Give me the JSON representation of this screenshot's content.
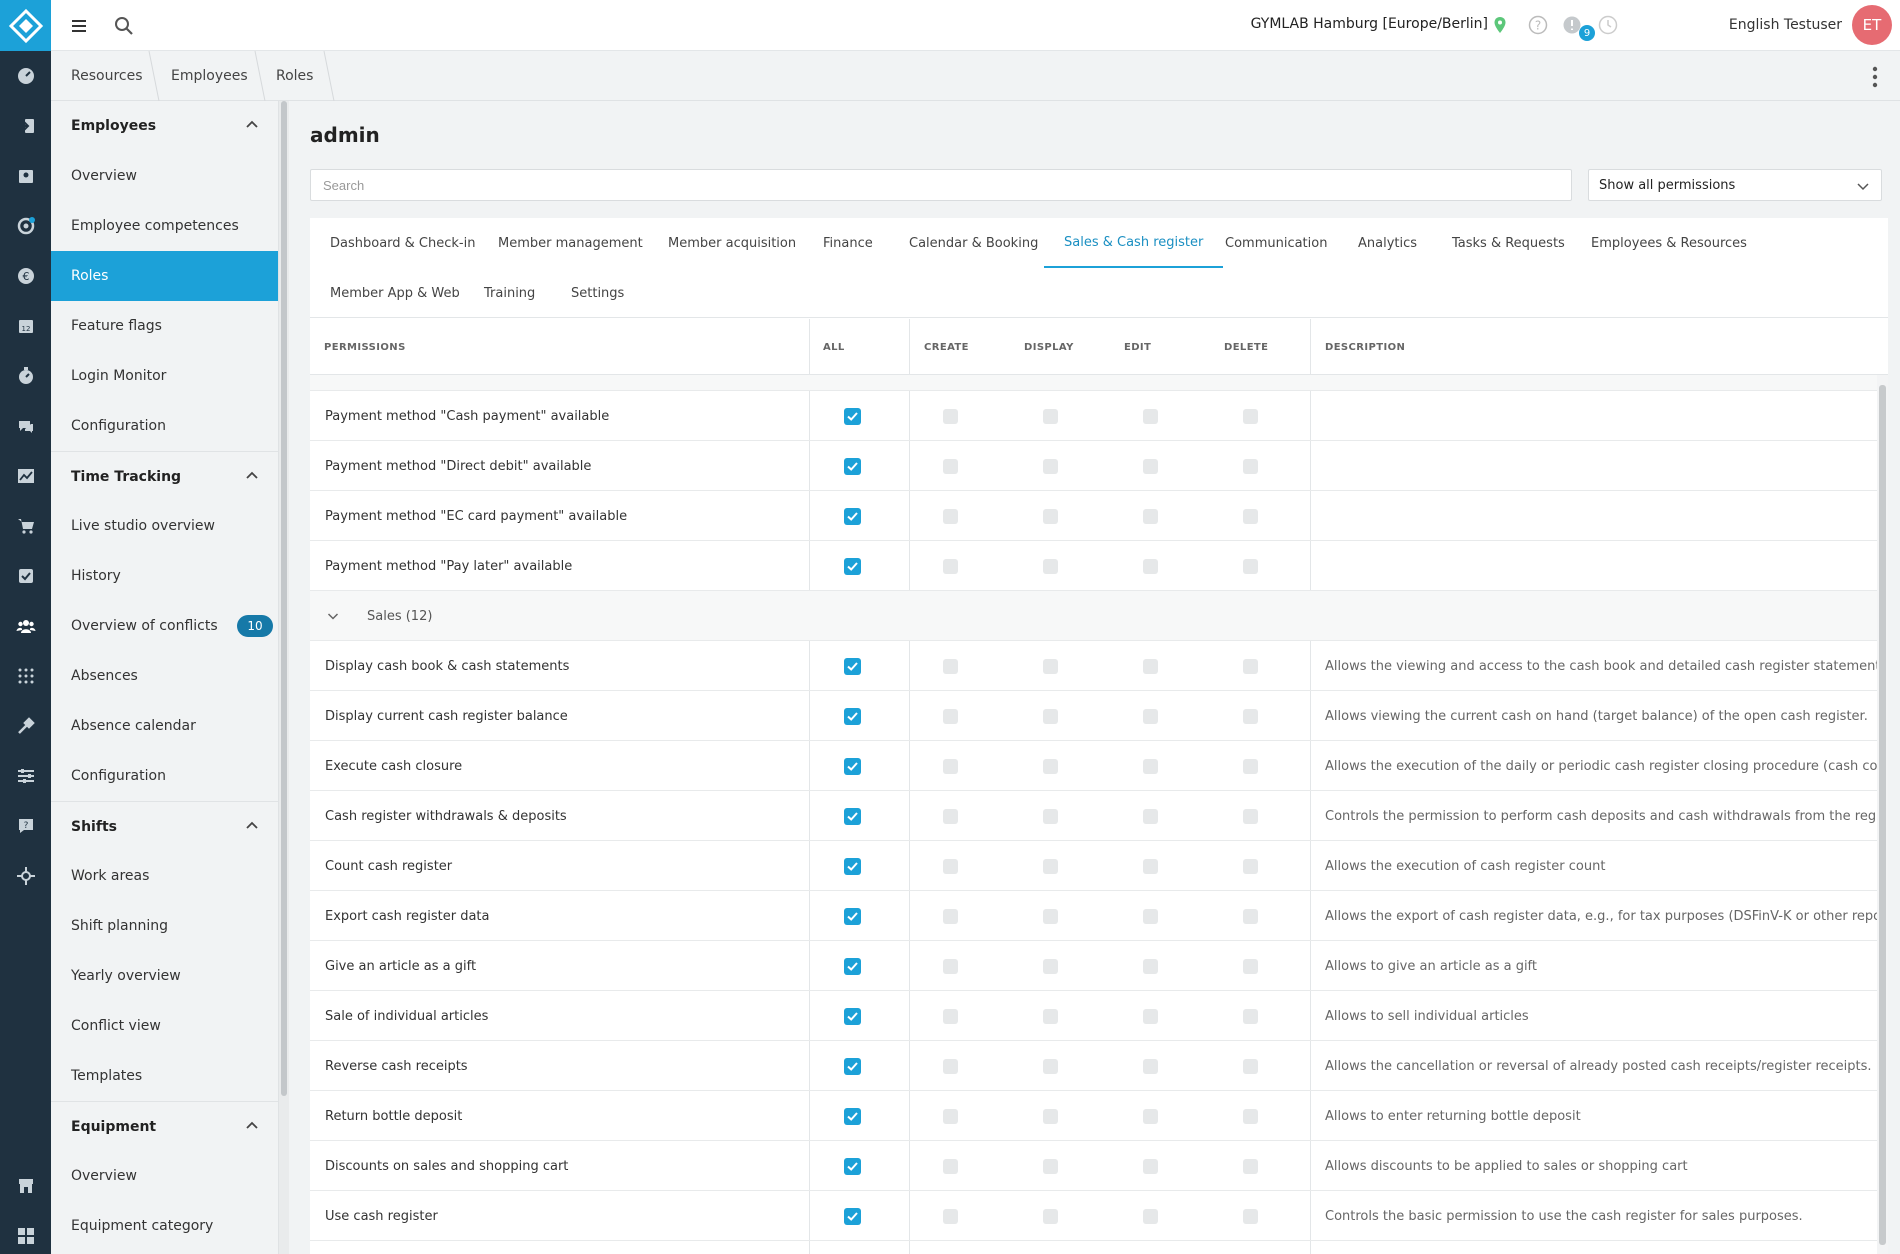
{
  "header": {
    "studio": "GYMLAB Hamburg [Europe/Berlin]",
    "notification_count": "9",
    "user_name": "English Testuser",
    "avatar_initials": "ET"
  },
  "breadcrumb": [
    "Resources",
    "Employees",
    "Roles"
  ],
  "sidebar": {
    "groups": [
      {
        "label": "Employees",
        "items": [
          "Overview",
          "Employee competences",
          "Roles",
          "Feature flags",
          "Login Monitor",
          "Configuration"
        ]
      },
      {
        "label": "Time Tracking",
        "items": [
          "Live studio overview",
          "History",
          "Overview of conflicts",
          "Absences",
          "Absence calendar",
          "Configuration"
        ]
      },
      {
        "label": "Shifts",
        "items": [
          "Work areas",
          "Shift planning",
          "Yearly overview",
          "Conflict view",
          "Templates"
        ]
      },
      {
        "label": "Equipment",
        "items": [
          "Overview",
          "Equipment category"
        ]
      }
    ],
    "active_item": "Roles",
    "conflicts_count": "10"
  },
  "page": {
    "title": "admin",
    "search_placeholder": "Search",
    "filter_value": "Show all permissions"
  },
  "tabs": [
    "Dashboard & Check-in",
    "Member management",
    "Member acquisition",
    "Finance",
    "Calendar & Booking",
    "Sales & Cash register",
    "Communication",
    "Analytics",
    "Tasks & Requests",
    "Employees & Resources",
    "Member App & Web",
    "Training",
    "Settings"
  ],
  "active_tab": "Sales & Cash register",
  "columns": {
    "permissions": "PERMISSIONS",
    "all": "ALL",
    "create": "CREATE",
    "display": "DISPLAY",
    "edit": "EDIT",
    "delete": "DELETE",
    "description": "DESCRIPTION"
  },
  "payment_rows": [
    {
      "name": "Payment method \"Cash payment\" available",
      "all": true,
      "description": ""
    },
    {
      "name": "Payment method \"Direct debit\" available",
      "all": true,
      "description": ""
    },
    {
      "name": "Payment method \"EC card payment\" available",
      "all": true,
      "description": ""
    },
    {
      "name": "Payment method \"Pay later\" available",
      "all": true,
      "description": ""
    }
  ],
  "sales_section": {
    "label": "Sales (12)",
    "rows": [
      {
        "name": "Display cash book & cash statements",
        "all": true,
        "description": "Allows the viewing and access to the cash book and detailed cash register statements."
      },
      {
        "name": "Display current cash register balance",
        "all": true,
        "description": "Allows viewing the current cash on hand (target balance) of the open cash register."
      },
      {
        "name": "Execute cash closure",
        "all": true,
        "description": "Allows the execution of the daily or periodic cash register closing procedure (cash count)."
      },
      {
        "name": "Cash register withdrawals & deposits",
        "all": true,
        "description": "Controls the permission to perform cash deposits and cash withdrawals from the register."
      },
      {
        "name": "Count cash register",
        "all": true,
        "description": "Allows the execution of cash register count"
      },
      {
        "name": "Export cash register data",
        "all": true,
        "description": "Allows the export of cash register data, e.g., for tax purposes (DSFinV-K or other reports)."
      },
      {
        "name": "Give an article as a gift",
        "all": true,
        "description": "Allows to give an article as a gift"
      },
      {
        "name": "Sale of individual articles",
        "all": true,
        "description": "Allows to sell individual articles"
      },
      {
        "name": "Reverse cash receipts",
        "all": true,
        "description": "Allows the cancellation or reversal of already posted cash receipts/register receipts."
      },
      {
        "name": "Return bottle deposit",
        "all": true,
        "description": "Allows to enter returning bottle deposit"
      },
      {
        "name": "Discounts on sales and shopping cart",
        "all": true,
        "description": "Allows discounts to be applied to sales or shopping cart"
      },
      {
        "name": "Use cash register",
        "all": true,
        "description": "Controls the basic permission to use the cash register for sales purposes."
      }
    ]
  },
  "colors": {
    "accent": "#1ca1d8",
    "rail": "#1f3140",
    "avatar": "#e66b72"
  }
}
